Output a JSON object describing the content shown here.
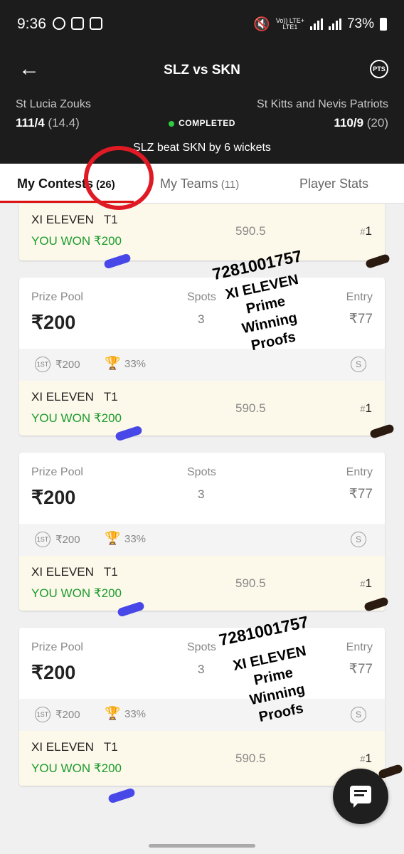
{
  "status_bar": {
    "time": "9:36",
    "network_top": "Vo)) LTE+",
    "network_bottom": "LTE1",
    "battery": "73%"
  },
  "header": {
    "title": "SLZ vs SKN",
    "pts_label": "PTS",
    "team_left": "St Lucia Zouks",
    "score_left": "111/4",
    "overs_left": "(14.4)",
    "team_right": "St Kitts and Nevis Patriots",
    "score_right": "110/9",
    "overs_right": "(20)",
    "status": "COMPLETED",
    "result": "SLZ beat SKN by 6 wickets"
  },
  "tabs": [
    {
      "label": "My Contests",
      "count": "(26)"
    },
    {
      "label": "My Teams",
      "count": "(11)"
    },
    {
      "label": "Player Stats",
      "count": ""
    }
  ],
  "labels": {
    "prize_pool": "Prize Pool",
    "spots": "Spots",
    "entry": "Entry",
    "first_badge": "1ST",
    "s_badge": "S"
  },
  "partial_card": {
    "team_name": "XI ELEVEN",
    "team_tag": "T1",
    "won": "YOU WON ₹200",
    "points": "590.5",
    "rank": "1"
  },
  "contests": [
    {
      "prize_pool": "₹200",
      "spots": "3",
      "entry": "₹77",
      "first_prize": "₹200",
      "win_pct": "33%",
      "team_name": "XI ELEVEN",
      "team_tag": "T1",
      "won": "YOU WON ₹200",
      "points": "590.5",
      "rank": "1"
    },
    {
      "prize_pool": "₹200",
      "spots": "3",
      "entry": "₹77",
      "first_prize": "₹200",
      "win_pct": "33%",
      "team_name": "XI ELEVEN",
      "team_tag": "T1",
      "won": "YOU WON ₹200",
      "points": "590.5",
      "rank": "1"
    },
    {
      "prize_pool": "₹200",
      "spots": "3",
      "entry": "₹77",
      "first_prize": "₹200",
      "win_pct": "33%",
      "team_name": "XI ELEVEN",
      "team_tag": "T1",
      "won": "YOU WON ₹200",
      "points": "590.5",
      "rank": "1"
    }
  ],
  "overlays": [
    {
      "phone": "7281001757",
      "line1": "XI ELEVEN",
      "line2": "Prime",
      "line3": "Winning",
      "line4": "Proofs"
    },
    {
      "phone": "7281001757",
      "line1": "XI ELEVEN",
      "line2": "Prime",
      "line3": "Winning",
      "line4": "Proofs"
    }
  ],
  "colors": {
    "header_bg": "#1c1c1c",
    "accent_red": "#d11111",
    "won_green": "#1a9a2c",
    "team_row_bg": "#fdf9ea"
  }
}
